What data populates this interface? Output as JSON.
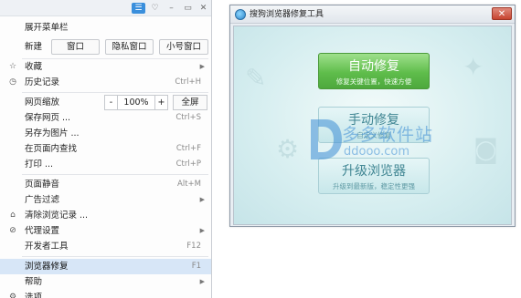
{
  "menu": {
    "topbar_icons": [
      "menu-icon",
      "skin-icon",
      "minimize-icon",
      "maximize-icon",
      "close-icon"
    ],
    "expand_label": "展开菜单栏",
    "new_label": "新建",
    "new_buttons": [
      "窗口",
      "隐私窗口",
      "小号窗口"
    ],
    "items": {
      "favorites": "收藏",
      "history": "历史记录",
      "history_shortcut": "Ctrl+H",
      "zoom": "网页缩放",
      "zoom_minus": "-",
      "zoom_value": "100%",
      "zoom_plus": "+",
      "fullscreen": "全屏",
      "save_page": "保存网页 ...",
      "save_page_shortcut": "Ctrl+S",
      "save_as_image": "另存为图片 ...",
      "find": "在页面内查找",
      "find_shortcut": "Ctrl+F",
      "print": "打印 ...",
      "print_shortcut": "Ctrl+P",
      "mute": "页面静音",
      "mute_shortcut": "Alt+M",
      "ad_filter": "广告过滤",
      "clear_history": "清除浏览记录 ...",
      "proxy": "代理设置",
      "devtools": "开发者工具",
      "devtools_shortcut": "F12",
      "browser_repair": "浏览器修复",
      "browser_repair_shortcut": "F1",
      "help": "帮助",
      "options": "选项"
    }
  },
  "repair_window": {
    "title": "搜狗浏览器修复工具",
    "close_glyph": "✕",
    "buttons": {
      "auto_title": "自动修复",
      "auto_sub": "修复关键位置，快速方便",
      "manual_title": "手动修复",
      "manual_sub": "自定义修复",
      "upgrade_title": "升级浏览器",
      "upgrade_sub": "升级到最新版，稳定性更强"
    }
  },
  "watermark": {
    "cn": "多多软件站",
    "en": "ddooo.com"
  },
  "colors": {
    "accent": "#3a8fdc",
    "highlight": "#d7e6f7",
    "auto_repair_green": "#5fbd4b",
    "watermark_blue": "#3f8fd6"
  }
}
